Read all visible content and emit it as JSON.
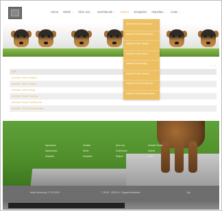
{
  "header": {
    "nav": [
      {
        "label": "Home",
        "has_menu": false,
        "active": false
      },
      {
        "label": "Würfe",
        "has_menu": true,
        "active": false
      },
      {
        "label": "Über uns",
        "has_menu": true,
        "active": false
      },
      {
        "label": "Zuchthunde",
        "has_menu": true,
        "active": false
      },
      {
        "label": "Galerie",
        "has_menu": false,
        "active": true
      },
      {
        "label": "Einspieler",
        "has_menu": false,
        "active": false
      },
      {
        "label": "Aktuelles",
        "has_menu": true,
        "active": false
      },
      {
        "label": "Links",
        "has_menu": true,
        "active": false
      }
    ]
  },
  "dropdown": {
    "items": [
      "Airedale Terrier Junghunde",
      "Airedale Terrier Ausstellung",
      "Airedale Terrier Welpen",
      "Airedale Terrier Urlaub",
      "Airedale Terrier Alltag",
      "Airedale Terrier Training",
      "Airedale Terrier Zuchthunde",
      "Airedale Terrier Erinnerungen"
    ]
  },
  "main": {
    "pager": {
      "prev": "‹",
      "next": "›"
    },
    "list": [
      {
        "label": "Titel",
        "header": true
      },
      {
        "label": "Airedale Terrier Welpen"
      },
      {
        "label": "Airedale Terrier Urlaub"
      },
      {
        "label": "Airedale Terrier Alltag"
      },
      {
        "label": "Airedale Terrier Training"
      },
      {
        "label": "Airedale Terrier Zuchthunde"
      },
      {
        "label": "Airedale Terrier Erinnerungen"
      }
    ]
  },
  "footer_links": [
    "Impressum",
    "Kontakt",
    "Über uns",
    "Airedale Terrier",
    "Datenschutz",
    "Würfe",
    "Zuchthunde",
    "Galerie",
    "Aktuelles",
    "Einspieler",
    "Welpen",
    "Links"
  ],
  "footer": {
    "left": "letzte Änderung: 17.03.2023",
    "center": "© 2015 - 2023 A.C. Rogues Airedales",
    "right": "Top"
  },
  "colors": {
    "accent": "#ecc062",
    "footer": "#6e6e6e",
    "grass": "#4f8e2a"
  }
}
